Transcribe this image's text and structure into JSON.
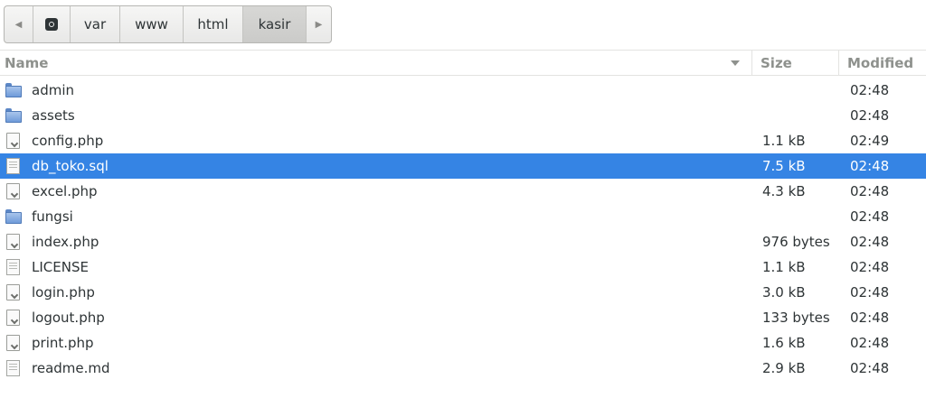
{
  "breadcrumb": {
    "segments": [
      "var",
      "www",
      "html",
      "kasir"
    ],
    "active": "kasir"
  },
  "columns": {
    "name": "Name",
    "size": "Size",
    "modified": "Modified"
  },
  "files": [
    {
      "name": "admin",
      "type": "folder",
      "size": "",
      "modified": "02:48"
    },
    {
      "name": "assets",
      "type": "folder",
      "size": "",
      "modified": "02:48"
    },
    {
      "name": "config.php",
      "type": "script",
      "size": "1.1 kB",
      "modified": "02:49"
    },
    {
      "name": "db_toko.sql",
      "type": "text",
      "size": "7.5 kB",
      "modified": "02:48",
      "selected": true
    },
    {
      "name": "excel.php",
      "type": "script",
      "size": "4.3 kB",
      "modified": "02:48"
    },
    {
      "name": "fungsi",
      "type": "folder",
      "size": "",
      "modified": "02:48"
    },
    {
      "name": "index.php",
      "type": "script",
      "size": "976 bytes",
      "modified": "02:48"
    },
    {
      "name": "LICENSE",
      "type": "text",
      "size": "1.1 kB",
      "modified": "02:48"
    },
    {
      "name": "login.php",
      "type": "script",
      "size": "3.0 kB",
      "modified": "02:48"
    },
    {
      "name": "logout.php",
      "type": "script",
      "size": "133 bytes",
      "modified": "02:48"
    },
    {
      "name": "print.php",
      "type": "script",
      "size": "1.6 kB",
      "modified": "02:48"
    },
    {
      "name": "readme.md",
      "type": "text",
      "size": "2.9 kB",
      "modified": "02:48"
    }
  ],
  "colors": {
    "selection": "#3584e4",
    "header_text": "#8e918d"
  }
}
